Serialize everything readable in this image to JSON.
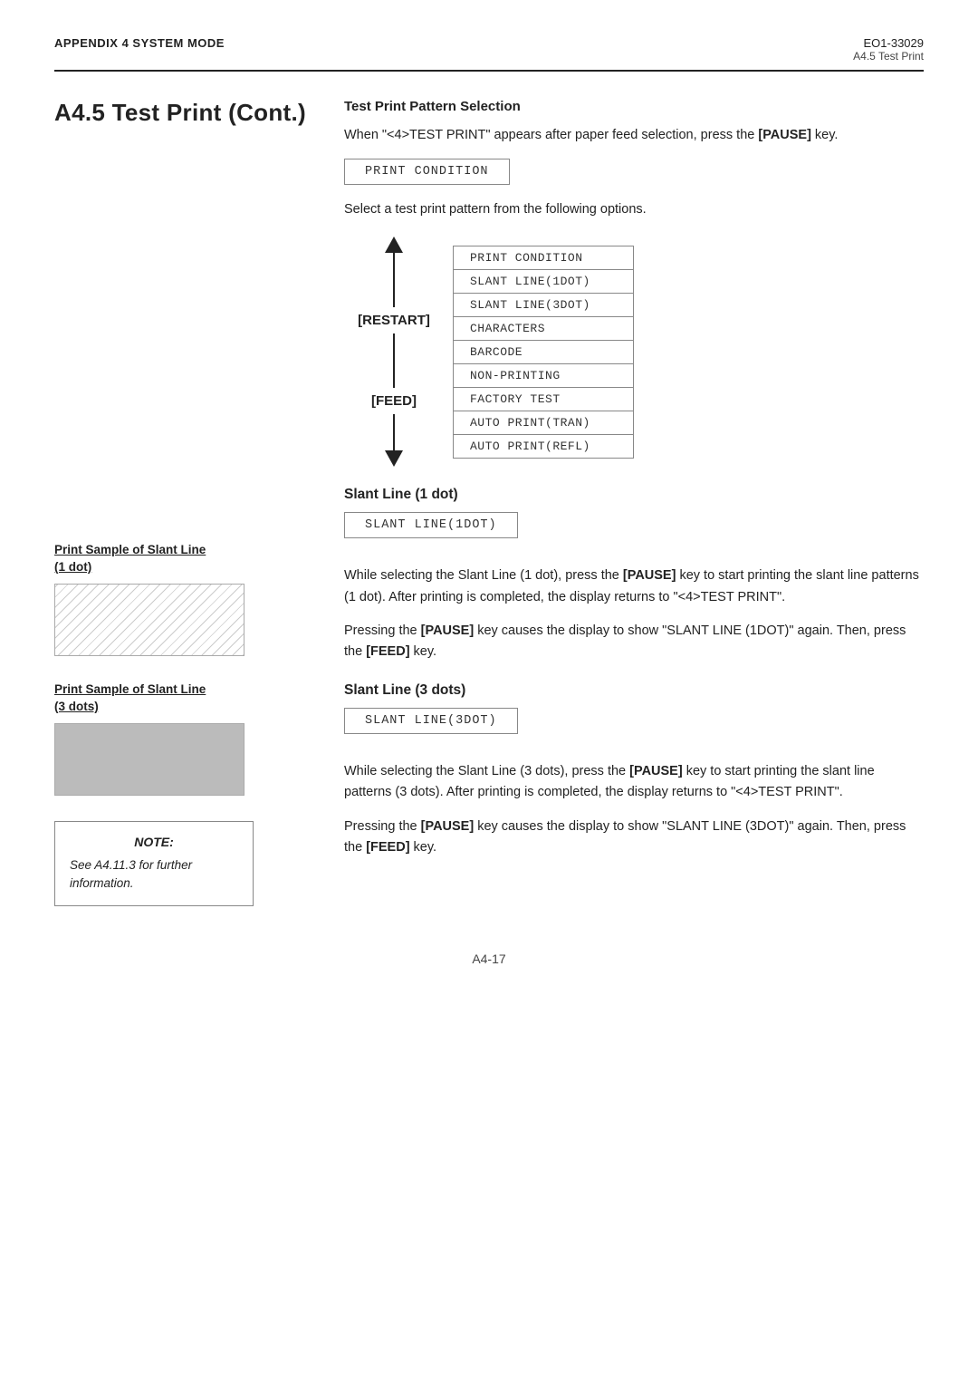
{
  "header": {
    "left": "APPENDIX 4 SYSTEM MODE",
    "doc_id": "EO1-33029",
    "section": "A4.5 Test Print"
  },
  "page_title": "A4.5 Test Print (Cont.)",
  "test_print_pattern": {
    "heading": "Test Print Pattern Selection",
    "intro": "When \"<4>TEST PRINT\" appears after paper feed selection, press the ",
    "intro_bold": "[PAUSE]",
    "intro_end": " key.",
    "lcd1": "PRINT CONDITION",
    "select_text": "Select a test print pattern from the following options.",
    "restart_label": "[RESTART]",
    "feed_label": "[FEED]",
    "menu_items": [
      "PRINT CONDITION",
      "SLANT LINE(1DOT)",
      "SLANT LINE(3DOT)",
      "CHARACTERS",
      "BARCODE",
      "NON-PRINTING",
      "FACTORY TEST",
      "AUTO PRINT(TRAN)",
      "AUTO PRINT(REFL)"
    ]
  },
  "slant_1dot": {
    "heading": "Slant Line (1 dot)",
    "lcd": "SLANT LINE(1DOT)",
    "left_label_line1": "Print Sample of Slant Line",
    "left_label_line2": "(1 dot)",
    "para1_pre": "While selecting the Slant Line (1 dot), press the ",
    "para1_bold1": "[PAUSE]",
    "para1_mid": " key to start printing the slant line patterns (1 dot).  After printing is completed, the display returns to \"<4>TEST PRINT\".",
    "para2_pre": "Pressing the ",
    "para2_bold1": "[PAUSE]",
    "para2_mid": " key causes the display to show \"SLANT LINE (1DOT)\" again.  Then, press the ",
    "para2_bold2": "[FEED]",
    "para2_end": " key."
  },
  "slant_3dot": {
    "heading": "Slant Line (3 dots)",
    "lcd": "SLANT LINE(3DOT)",
    "left_label_line1": "Print Sample of Slant Line",
    "left_label_line2": "(3 dots)",
    "para1_pre": "While selecting the Slant Line (3 dots), press the ",
    "para1_bold1": "[PAUSE]",
    "para1_mid": " key to start printing the slant line patterns (3 dots).  After printing is completed, the display returns to \"<4>TEST PRINT\".",
    "para2_pre": "Pressing the ",
    "para2_bold1": "[PAUSE]",
    "para2_mid": " key causes the display to show \"SLANT LINE (3DOT)\" again.  Then, press the ",
    "para2_bold2": "[FEED]",
    "para2_end": " key."
  },
  "note": {
    "title": "NOTE:",
    "text": "See A4.11.3 for further information."
  },
  "footer": {
    "page": "A4-17"
  }
}
